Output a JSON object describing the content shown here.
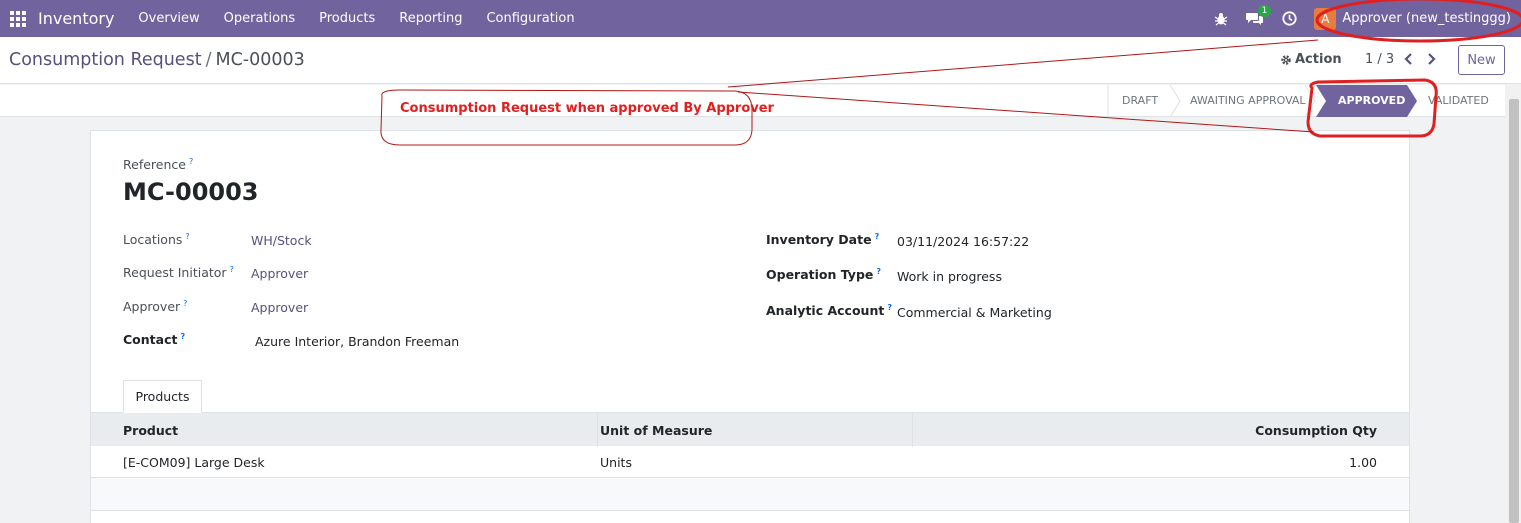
{
  "navbar": {
    "app_name": "Inventory",
    "menus": [
      "Overview",
      "Operations",
      "Products",
      "Reporting",
      "Configuration"
    ],
    "messages_badge": "1",
    "user": {
      "initial": "A",
      "name": "Approver (new_testinggg)"
    }
  },
  "control_panel": {
    "breadcrumb_parent": "Consumption Request",
    "breadcrumb_current": "MC-00003",
    "action_label": "Action",
    "pager": "1 / 3",
    "new_label": "New"
  },
  "statusbar": {
    "stages": [
      "DRAFT",
      "AWAITING APPROVAL",
      "APPROVED",
      "VALIDATED"
    ],
    "active_stage": "APPROVED"
  },
  "form": {
    "reference_label": "Reference",
    "reference_value": "MC-00003",
    "left_fields": [
      {
        "label": "Locations",
        "value": "WH/Stock"
      },
      {
        "label": "Request Initiator",
        "value": "Approver"
      },
      {
        "label": "Approver",
        "value": "Approver"
      },
      {
        "label": "Contact",
        "value": "Azure Interior, Brandon Freeman"
      }
    ],
    "right_fields": [
      {
        "label": "Inventory Date",
        "value": "03/11/2024 16:57:22"
      },
      {
        "label": "Operation Type",
        "value": "Work in progress"
      },
      {
        "label": "Analytic Account",
        "value": "Commercial & Marketing"
      }
    ],
    "help_mark": "?"
  },
  "tabs": {
    "products": "Products"
  },
  "table": {
    "headers": [
      "Product",
      "Unit of Measure",
      "Consumption Qty"
    ],
    "rows": [
      [
        "[E-COM09] Large Desk",
        "Units",
        "1.00"
      ]
    ]
  },
  "annotation": {
    "text": "Consumption Request when approved By Approver",
    "color": "#e02020"
  },
  "colors": {
    "brand": "#71639e",
    "link": "#5a4f7c",
    "badge": "#28a745",
    "avatar": "#e87c3e"
  }
}
